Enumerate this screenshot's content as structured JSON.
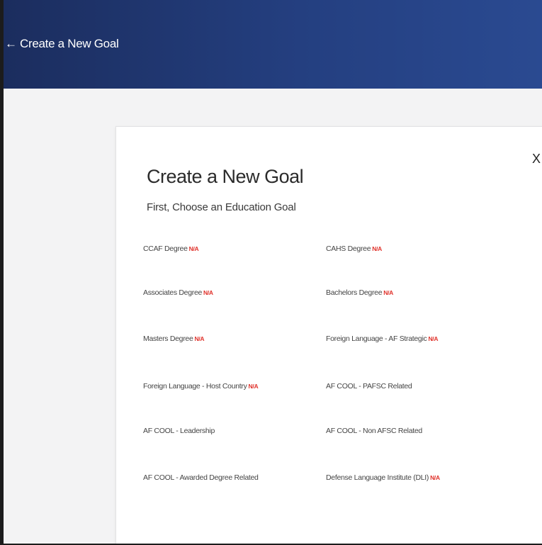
{
  "header": {
    "back_icon": "←",
    "back_label": "Create a New Goal"
  },
  "modal": {
    "close_label": "X",
    "title": "Create a New Goal",
    "subtitle": "First, Choose an Education Goal",
    "goals": [
      {
        "label": "CCAF Degree",
        "badge": "N/A"
      },
      {
        "label": "CAHS Degree",
        "badge": "N/A"
      },
      {
        "label": "Associates Degree",
        "badge": "N/A"
      },
      {
        "label": "Bachelors Degree",
        "badge": "N/A"
      },
      {
        "label": "Masters Degree",
        "badge": "N/A"
      },
      {
        "label": "Foreign Language - AF Strategic",
        "badge": "N/A"
      },
      {
        "label": "Foreign Language - Host Country",
        "badge": "N/A"
      },
      {
        "label": "AF COOL - PAFSC Related",
        "badge": ""
      },
      {
        "label": "AF COOL - Leadership",
        "badge": ""
      },
      {
        "label": "AF COOL - Non AFSC Related",
        "badge": ""
      },
      {
        "label": "AF COOL - Awarded Degree Related",
        "badge": ""
      },
      {
        "label": "Defense Language Institute (DLI)",
        "badge": "N/A"
      }
    ]
  },
  "colors": {
    "header_start": "#1b2d5e",
    "header_end": "#2a4a91",
    "badge": "#e0322b"
  }
}
